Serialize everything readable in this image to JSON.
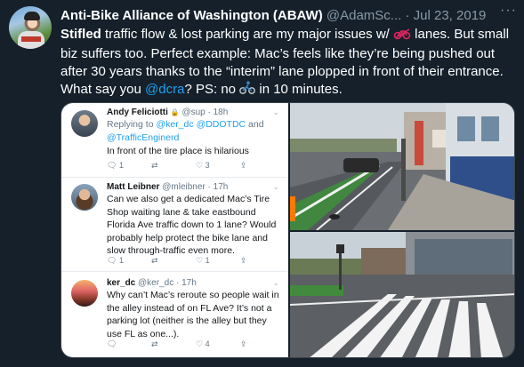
{
  "tweet": {
    "name": "Anti-Bike Alliance of Washington (ABAW)",
    "handle": "@AdamSc...",
    "date": "Jul 23, 2019",
    "dot": "·",
    "more_icon": "more-dots-icon",
    "text": {
      "p1_bold": "Stifled",
      "p1_a": " traffic flow & lost parking are my major issues w/ ",
      "p1_b": " lanes. But small biz suffers too. Perfect example: Mac’s feels like they’re being pushed out after 30 years thanks to the “interim” lane plopped in front of their entrance. What say you ",
      "p1_mention": "@dcra",
      "p1_c": "? PS: no ",
      "p1_d": " in 10 minutes.",
      "emoji_1": "bicycle-lane-icon",
      "emoji_2": "cyclist-icon"
    }
  },
  "replies": [
    {
      "name": "Andy Feliciotti",
      "badge": "🔒",
      "handle": "@sup",
      "time": "· 18h",
      "replying_prefix": "Replying to ",
      "replying_1": "@ker_dc",
      "replying_2": "@DDOTDC",
      "replying_and": " and",
      "replying_3": "@TrafficEnginerd",
      "text": "In front of the tire place is hilarious",
      "replies": "1",
      "retweets": "",
      "likes": "3"
    },
    {
      "name": "Matt Leibner",
      "handle": "@mleibner",
      "time": "· 17h",
      "text": "Can we also get a dedicated Mac’s Tire Shop waiting lane & take eastbound Florida Ave traffic down to 1 lane? Would probably help protect the bike lane and slow through-traffic even more.",
      "replies": "1",
      "retweets": "",
      "likes": "1"
    },
    {
      "name": "ker_dc",
      "handle": "@ker_dc",
      "time": "· 17h",
      "text": "Why can’t Mac’s reroute so people wait in the alley instead of on FL Ave? It’s not a parking lot (neither is the alley but they use FL as one...).",
      "replies": "",
      "retweets": "",
      "likes": "4"
    }
  ],
  "colors": {
    "background": "#15202b",
    "link": "#1da1f2",
    "muted": "#8899a6"
  }
}
